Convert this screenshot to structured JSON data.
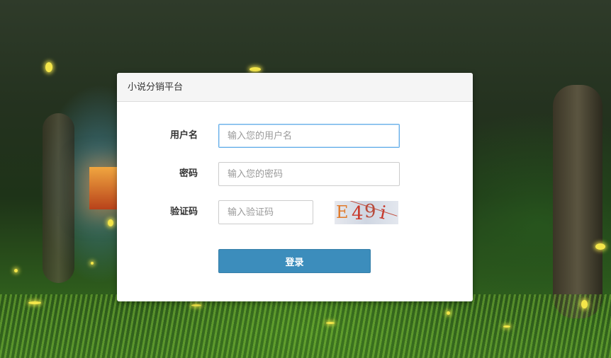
{
  "dialog": {
    "title": "小说分销平台"
  },
  "form": {
    "username": {
      "label": "用户名",
      "placeholder": "输入您的用户名",
      "value": ""
    },
    "password": {
      "label": "密码",
      "placeholder": "输入您的密码",
      "value": ""
    },
    "captcha": {
      "label": "验证码",
      "placeholder": "输入验证码",
      "value": "",
      "image_text": [
        "E",
        "4",
        "9",
        "i"
      ],
      "image_colors": [
        "#e07a2a",
        "#c8372a",
        "#b84a3a",
        "#c8372a"
      ]
    },
    "submit_label": "登录"
  },
  "colors": {
    "accent": "#3c8dbc",
    "focus_border": "#66afe9",
    "header_bg": "#f5f5f5"
  }
}
